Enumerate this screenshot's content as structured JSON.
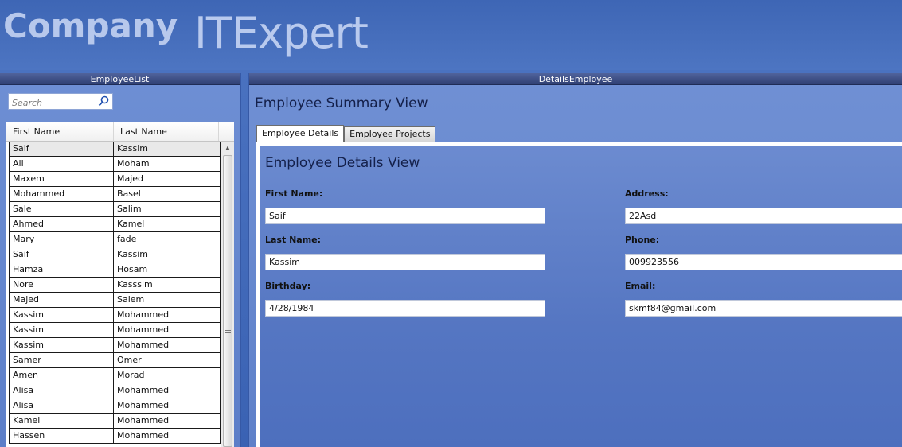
{
  "header": {
    "company": "Company",
    "product": "ITExpert"
  },
  "employee_list": {
    "title": "EmployeeList",
    "search_placeholder": "Search",
    "columns": [
      "First Name",
      "Last Name"
    ],
    "rows": [
      [
        "Saif",
        "Kassim"
      ],
      [
        "Ali",
        "Moham"
      ],
      [
        "Maxem",
        "Majed"
      ],
      [
        "Mohammed",
        "Basel"
      ],
      [
        "Sale",
        "Salim"
      ],
      [
        "Ahmed",
        "Kamel"
      ],
      [
        "Mary",
        "fade"
      ],
      [
        "Saif",
        "Kassim"
      ],
      [
        "Hamza",
        "Hosam"
      ],
      [
        "Nore",
        "Kasssim"
      ],
      [
        "Majed",
        "Salem"
      ],
      [
        "Kassim",
        "Mohammed"
      ],
      [
        "Kassim",
        "Mohammed"
      ],
      [
        "Kassim",
        "Mohammed"
      ],
      [
        "Samer",
        "Omer"
      ],
      [
        "Amen",
        "Morad"
      ],
      [
        "Alisa",
        "Mohammed"
      ],
      [
        "Alisa",
        "Mohammed"
      ],
      [
        "Kamel",
        "Mohammed"
      ],
      [
        "Hassen",
        "Mohammed"
      ]
    ]
  },
  "details": {
    "title": "DetailsEmployee",
    "summary_title": "Employee Summary View",
    "tabs": [
      "Employee Details",
      "Employee Projects"
    ],
    "active_tab": "Employee Details",
    "view_title": "Employee Details View",
    "fields": {
      "first_name": {
        "label": "First Name:",
        "value": "Saif"
      },
      "last_name": {
        "label": "Last Name:",
        "value": "Kassim"
      },
      "birthday": {
        "label": "Birthday:",
        "value": "4/28/1984"
      },
      "address": {
        "label": "Address:",
        "value": "22Asd"
      },
      "phone": {
        "label": "Phone:",
        "value": "009923556"
      },
      "email": {
        "label": "Email:",
        "value": "skmf84@gmail.com"
      }
    }
  },
  "colors": {
    "background": "#3f67b6",
    "panel_title_bar": "#2f3f73",
    "brand_text": "#b7c8ec"
  }
}
